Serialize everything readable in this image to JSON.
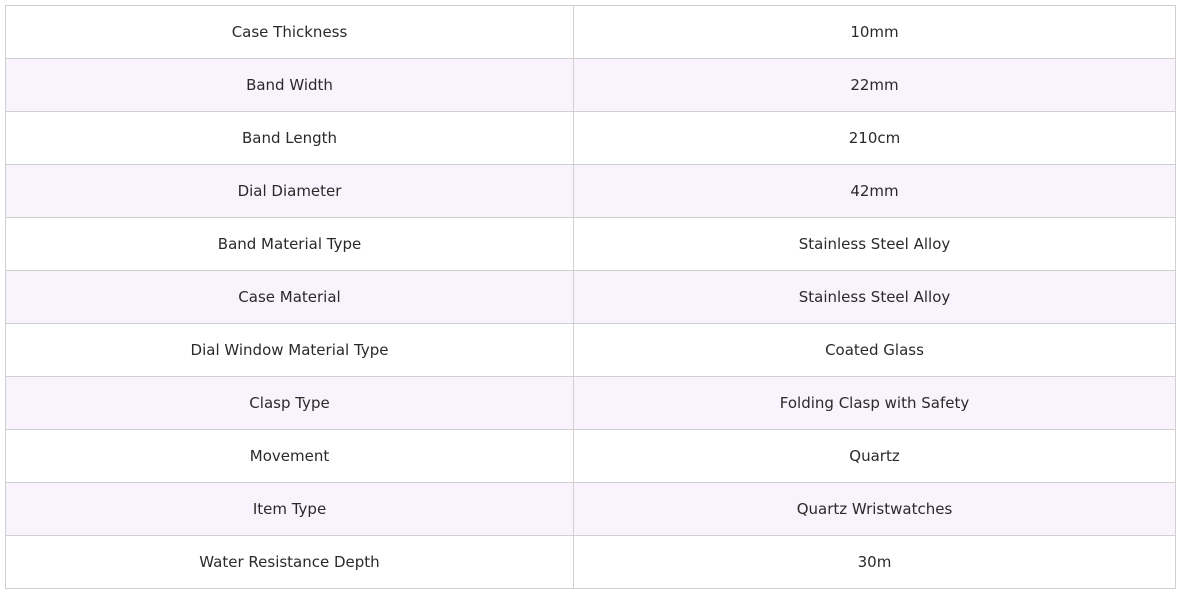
{
  "colors": {
    "row_odd": "#ffffff",
    "row_even": "#f8f3fd",
    "border": "#d0d0d0",
    "text": "#2a2a2a"
  },
  "specs": [
    {
      "label": "Case Thickness",
      "value": "10mm"
    },
    {
      "label": "Band Width",
      "value": "22mm"
    },
    {
      "label": "Band Length",
      "value": "210cm"
    },
    {
      "label": "Dial Diameter",
      "value": "42mm"
    },
    {
      "label": "Band Material Type",
      "value": "Stainless Steel Alloy"
    },
    {
      "label": "Case Material",
      "value": "Stainless Steel Alloy"
    },
    {
      "label": "Dial Window Material Type",
      "value": "Coated Glass"
    },
    {
      "label": "Clasp Type",
      "value": "Folding Clasp with Safety"
    },
    {
      "label": "Movement",
      "value": "Quartz"
    },
    {
      "label": "Item Type",
      "value": "Quartz Wristwatches"
    },
    {
      "label": "Water Resistance Depth",
      "value": "30m"
    }
  ]
}
